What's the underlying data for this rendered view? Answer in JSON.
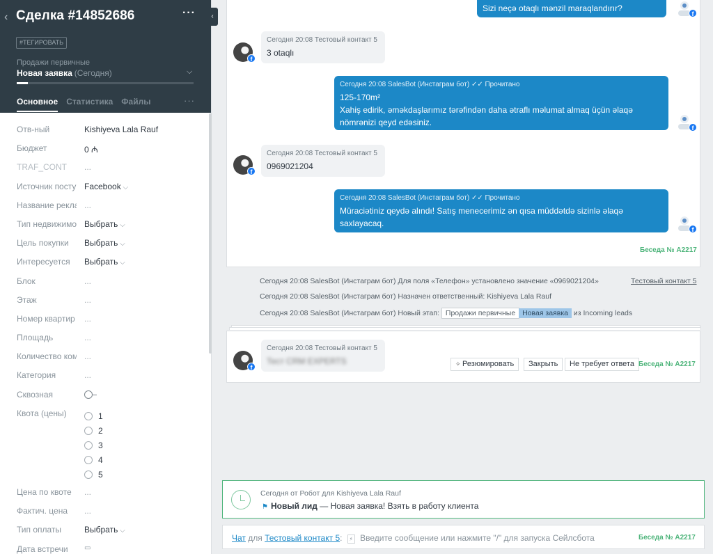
{
  "deal": {
    "title": "Сделка #14852686",
    "tag_button": "#ТЕГИРОВАТЬ",
    "pipeline": "Продажи первичные",
    "stage": "Новая заявка",
    "stage_date": "(Сегодня)",
    "tabs": [
      "Основное",
      "Статистика",
      "Файлы"
    ]
  },
  "fields": [
    {
      "label": "Отв-ный",
      "value": "Kishiyeva Lala Rauf"
    },
    {
      "label": "Бюджет",
      "value": "0 ₼"
    },
    {
      "label": "TRAF_CONT",
      "value": "..."
    },
    {
      "label": "Источник посту",
      "value": "Facebook"
    },
    {
      "label": "Название рекла",
      "value": "..."
    },
    {
      "label": "Тип недвижимо",
      "value": "Выбрать"
    },
    {
      "label": "Цель покупки",
      "value": "Выбрать"
    },
    {
      "label": "Интересуется",
      "value": "Выбрать"
    },
    {
      "label": "Блок",
      "value": "..."
    },
    {
      "label": "Этаж",
      "value": "..."
    },
    {
      "label": "Номер квартир",
      "value": "..."
    },
    {
      "label": "Площадь",
      "value": "..."
    },
    {
      "label": "Количество ком",
      "value": "..."
    },
    {
      "label": "Категория",
      "value": "..."
    },
    {
      "label": "Сквозная",
      "value": ""
    },
    {
      "label": "Квота (цены)",
      "value": ""
    }
  ],
  "quota_options": [
    "1",
    "2",
    "3",
    "4",
    "5"
  ],
  "fields_bottom": [
    {
      "label": "Цена по квоте",
      "value": "..."
    },
    {
      "label": "Фактич. цена",
      "value": "..."
    },
    {
      "label": "Тип оплаты",
      "value": "Выбрать"
    },
    {
      "label": "Дата встречи",
      "value": ""
    }
  ],
  "chat": {
    "top_out": "Sizi neçə otaqlı mənzil maraqlandırır?",
    "in1_meta": "Сегодня 20:08 Тестовый контакт 5",
    "in1_text": "3 otaqlı",
    "out2_meta": "Сегодня 20:08 SalesBot (Инстаграм бот) ✓✓ Прочитано",
    "out2_line1": "125-170m²",
    "out2_line2": "Xahiş edirik, əməkdaşlarımız tərəfindən daha ətraflı məlumat almaq üçün əlaqə",
    "out2_line3": "nömrənizi qeyd edəsiniz.",
    "in2_meta": "Сегодня 20:08 Тестовый контакт 5",
    "in2_text": "0969021204",
    "out3_meta": "Сегодня 20:08 SalesBot (Инстаграм бот) ✓✓ Прочитано",
    "out3_line1": "Müraciətiniz qeydə alındı! Satış menecerimiz ən qısa müddətdə sizinlə əlaqə",
    "out3_line2": "saxlayacaq.",
    "conv_id": "Беседа № A2217"
  },
  "system": {
    "line1": "Сегодня 20:08 SalesBot (Инстаграм бот) Для поля «Телефон» установлено значение «0969021204»",
    "line1_contact": "Тестовый контакт 5",
    "line2": "Сегодня 20:08 SalesBot (Инстаграм бот) Назначен ответственный: Kishiyeva Lala Rauf",
    "line3_prefix": "Сегодня 20:08 SalesBot (Инстаграм бот) Новый этап:",
    "line3_pipeline": "Продажи первичные",
    "line3_stage": "Новая заявка",
    "line3_suffix": "из Incoming leads"
  },
  "incoming": {
    "meta": "Сегодня 20:08 Тестовый контакт 5",
    "text": "Тест CRM EXPERTS",
    "btn_summarize": "Резюмировать",
    "btn_close": "Закрыть",
    "btn_no_reply": "Не требует ответа",
    "conv_id": "Беседа № A2217"
  },
  "task": {
    "meta": "Сегодня от Робот для Kishiyeva Lala Rauf",
    "bold": "Новый лид",
    "text": " — Новая заявка! Взять в работу клиента"
  },
  "composer": {
    "chat_link": "Чат",
    "for": "для",
    "contact_link": "Тестовый контакт 5",
    "placeholder": "Введите сообщение или нажмите \"/\" для запуска Сейлсбота",
    "conv_id": "Беседа № A2217"
  }
}
